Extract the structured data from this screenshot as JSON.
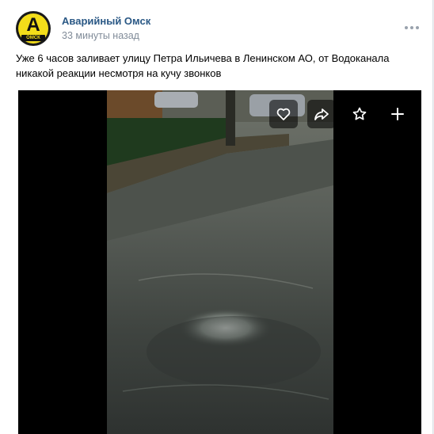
{
  "post": {
    "author": "Аварийный Омск",
    "time": "33 минуты назад",
    "text": "Уже 6 часов заливает улицу Петра Ильичева в Ленинском АО, от Водоканала никакой реакции несмотря на кучу звонков",
    "avatar": {
      "letter": "A",
      "strip": "ОМСК",
      "colors": {
        "ring": "#1a1a1a",
        "fill": "#f3dd1a"
      }
    }
  },
  "media_controls": [
    {
      "name": "like",
      "icon": "heart-icon"
    },
    {
      "name": "share",
      "icon": "share-arrow-icon"
    },
    {
      "name": "favorite",
      "icon": "star-icon"
    },
    {
      "name": "add",
      "icon": "plus-icon"
    }
  ],
  "colors": {
    "author_link": "#2a5885",
    "secondary_text": "#818c99",
    "page_bg": "#edeef0"
  }
}
